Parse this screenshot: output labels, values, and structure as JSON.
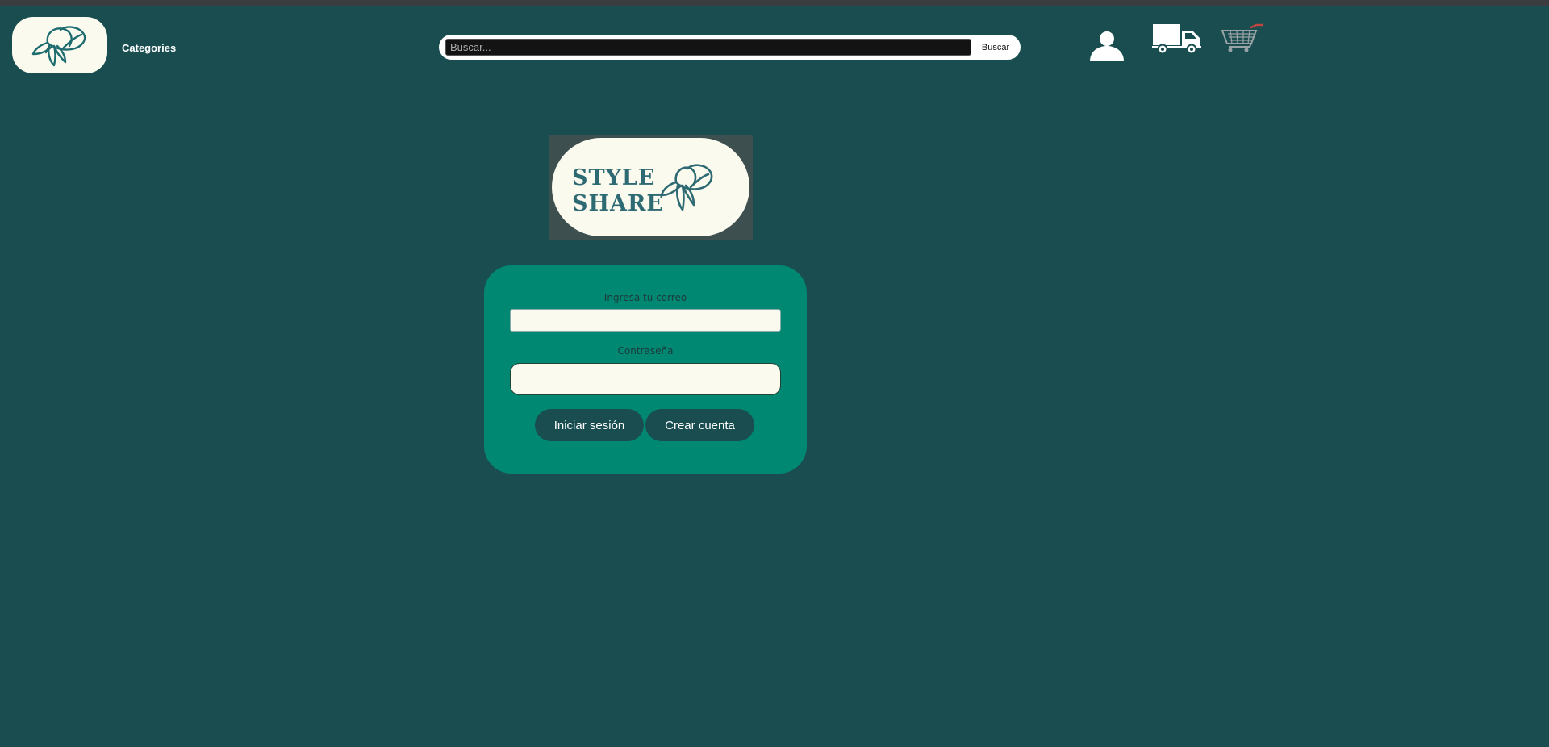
{
  "header": {
    "logo_icon": "hat-logo-icon",
    "categories_label": "Categories",
    "search": {
      "placeholder": "Buscar...",
      "value": "",
      "button_label": "Buscar"
    },
    "icons": [
      "user-icon",
      "truck-icon",
      "cart-icon"
    ]
  },
  "brand": {
    "line1": "STYLE",
    "line2": "SHARE",
    "icon": "hat-logo-icon"
  },
  "login": {
    "email_label": "Ingresa tu correo",
    "email_value": "",
    "password_label": "Contraseña",
    "password_value": "",
    "login_button": "Iniciar sesión",
    "create_button": "Crear cuenta"
  },
  "colors": {
    "background": "#194d50",
    "card": "#008873",
    "cream": "#fbfaee",
    "brand_text": "#2e6a73"
  }
}
